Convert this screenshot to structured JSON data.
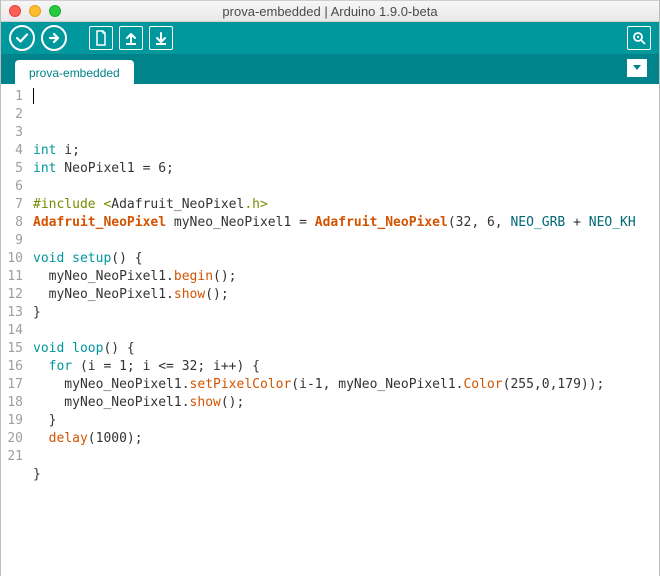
{
  "window": {
    "title": "prova-embedded | Arduino 1.9.0-beta"
  },
  "toolbar": {
    "verify": "verify-icon",
    "upload": "upload-icon",
    "new": "new-icon",
    "open": "open-icon",
    "save": "save-icon",
    "serial": "serial-monitor-icon"
  },
  "tab": {
    "name": "prova-embedded"
  },
  "code": {
    "lines": [
      [
        {
          "c": "kw",
          "t": "int"
        },
        {
          "c": "txt",
          "t": " i;"
        }
      ],
      [
        {
          "c": "kw",
          "t": "int"
        },
        {
          "c": "txt",
          "t": " NeoPixel1 = 6;"
        }
      ],
      [],
      [
        {
          "c": "pre",
          "t": "#include <"
        },
        {
          "c": "txt",
          "t": "Adafruit_NeoPixel"
        },
        {
          "c": "pre",
          "t": ".h>"
        }
      ],
      [
        {
          "c": "type",
          "t": "Adafruit_NeoPixel"
        },
        {
          "c": "txt",
          "t": " myNeo_NeoPixel1 = "
        },
        {
          "c": "type",
          "t": "Adafruit_NeoPixel"
        },
        {
          "c": "txt",
          "t": "(32, 6, "
        },
        {
          "c": "const",
          "t": "NEO_GRB"
        },
        {
          "c": "txt",
          "t": " + "
        },
        {
          "c": "const",
          "t": "NEO_KH"
        }
      ],
      [],
      [
        {
          "c": "kw",
          "t": "void"
        },
        {
          "c": "txt",
          "t": " "
        },
        {
          "c": "kw",
          "t": "setup"
        },
        {
          "c": "txt",
          "t": "() {"
        }
      ],
      [
        {
          "c": "txt",
          "t": "  myNeo_NeoPixel1."
        },
        {
          "c": "func",
          "t": "begin"
        },
        {
          "c": "txt",
          "t": "();"
        }
      ],
      [
        {
          "c": "txt",
          "t": "  myNeo_NeoPixel1."
        },
        {
          "c": "func",
          "t": "show"
        },
        {
          "c": "txt",
          "t": "();"
        }
      ],
      [
        {
          "c": "txt",
          "t": "}"
        }
      ],
      [],
      [
        {
          "c": "kw",
          "t": "void"
        },
        {
          "c": "txt",
          "t": " "
        },
        {
          "c": "kw",
          "t": "loop"
        },
        {
          "c": "txt",
          "t": "() {"
        }
      ],
      [
        {
          "c": "txt",
          "t": "  "
        },
        {
          "c": "kw",
          "t": "for"
        },
        {
          "c": "txt",
          "t": " (i = 1; i <= 32; i++) {"
        }
      ],
      [
        {
          "c": "txt",
          "t": "    myNeo_NeoPixel1."
        },
        {
          "c": "func",
          "t": "setPixelColor"
        },
        {
          "c": "txt",
          "t": "(i-1, myNeo_NeoPixel1."
        },
        {
          "c": "func",
          "t": "Color"
        },
        {
          "c": "txt",
          "t": "(255,0,179));"
        }
      ],
      [
        {
          "c": "txt",
          "t": "    myNeo_NeoPixel1."
        },
        {
          "c": "func",
          "t": "show"
        },
        {
          "c": "txt",
          "t": "();"
        }
      ],
      [
        {
          "c": "txt",
          "t": "  }"
        }
      ],
      [
        {
          "c": "txt",
          "t": "  "
        },
        {
          "c": "func",
          "t": "delay"
        },
        {
          "c": "txt",
          "t": "(1000);"
        }
      ],
      [],
      [
        {
          "c": "txt",
          "t": "}"
        }
      ],
      [],
      []
    ],
    "total_lines": 21
  }
}
